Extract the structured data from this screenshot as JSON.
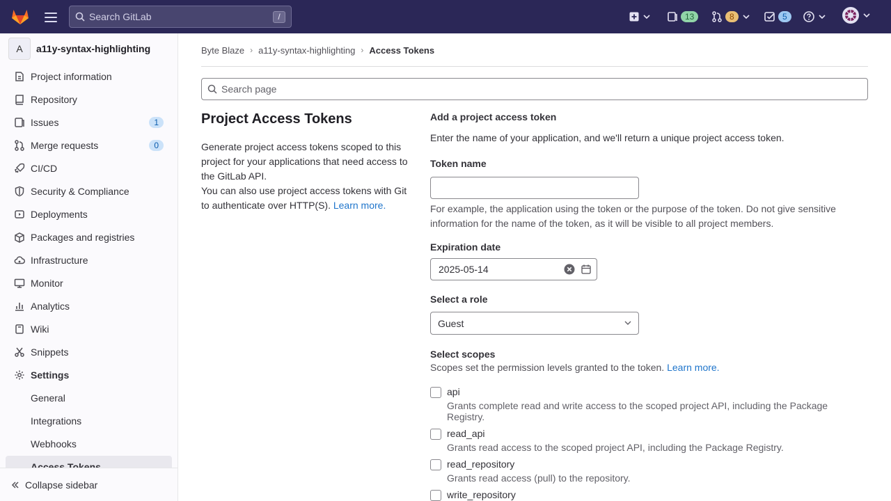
{
  "topbar": {
    "search_placeholder": "Search GitLab",
    "search_shortcut": "/",
    "issues_count": "13",
    "merge_requests_count": "8",
    "todos_count": "5"
  },
  "sidebar": {
    "project_initial": "A",
    "project_name": "a11y-syntax-highlighting",
    "items": [
      {
        "label": "Project information"
      },
      {
        "label": "Repository"
      },
      {
        "label": "Issues",
        "count": "1"
      },
      {
        "label": "Merge requests",
        "count": "0"
      },
      {
        "label": "CI/CD"
      },
      {
        "label": "Security & Compliance"
      },
      {
        "label": "Deployments"
      },
      {
        "label": "Packages and registries"
      },
      {
        "label": "Infrastructure"
      },
      {
        "label": "Monitor"
      },
      {
        "label": "Analytics"
      },
      {
        "label": "Wiki"
      },
      {
        "label": "Snippets"
      },
      {
        "label": "Settings"
      }
    ],
    "settings_sub": [
      {
        "label": "General"
      },
      {
        "label": "Integrations"
      },
      {
        "label": "Webhooks"
      },
      {
        "label": "Access Tokens"
      }
    ],
    "collapse_label": "Collapse sidebar"
  },
  "breadcrumb": {
    "group": "Byte Blaze",
    "project": "a11y-syntax-highlighting",
    "current": "Access Tokens"
  },
  "page_search_placeholder": "Search page",
  "left": {
    "title": "Project Access Tokens",
    "desc1": "Generate project access tokens scoped to this project for your applications that need access to the GitLab API.",
    "desc2": "You can also use project access tokens with Git to authenticate over HTTP(S).",
    "learn_more": "Learn more."
  },
  "form": {
    "title": "Add a project access token",
    "description": "Enter the name of your application, and we'll return a unique project access token.",
    "token_name_label": "Token name",
    "token_name_value": "",
    "token_name_help": "For example, the application using the token or the purpose of the token. Do not give sensitive information for the name of the token, as it will be visible to all project members.",
    "expiration_label": "Expiration date",
    "expiration_value": "2025-05-14",
    "role_label": "Select a role",
    "role_value": "Guest",
    "scopes_label": "Select scopes",
    "scopes_help": "Scopes set the permission levels granted to the token.",
    "scopes_learn_more": "Learn more.",
    "scopes": [
      {
        "name": "api",
        "desc": "Grants complete read and write access to the scoped project API, including the Package Registry."
      },
      {
        "name": "read_api",
        "desc": "Grants read access to the scoped project API, including the Package Registry."
      },
      {
        "name": "read_repository",
        "desc": "Grants read access (pull) to the repository."
      },
      {
        "name": "write_repository",
        "desc": ""
      }
    ]
  },
  "colors": {
    "topbar_bg": "#2b2757",
    "link": "#1f75cb",
    "logo_orange": "#fc6d26"
  }
}
